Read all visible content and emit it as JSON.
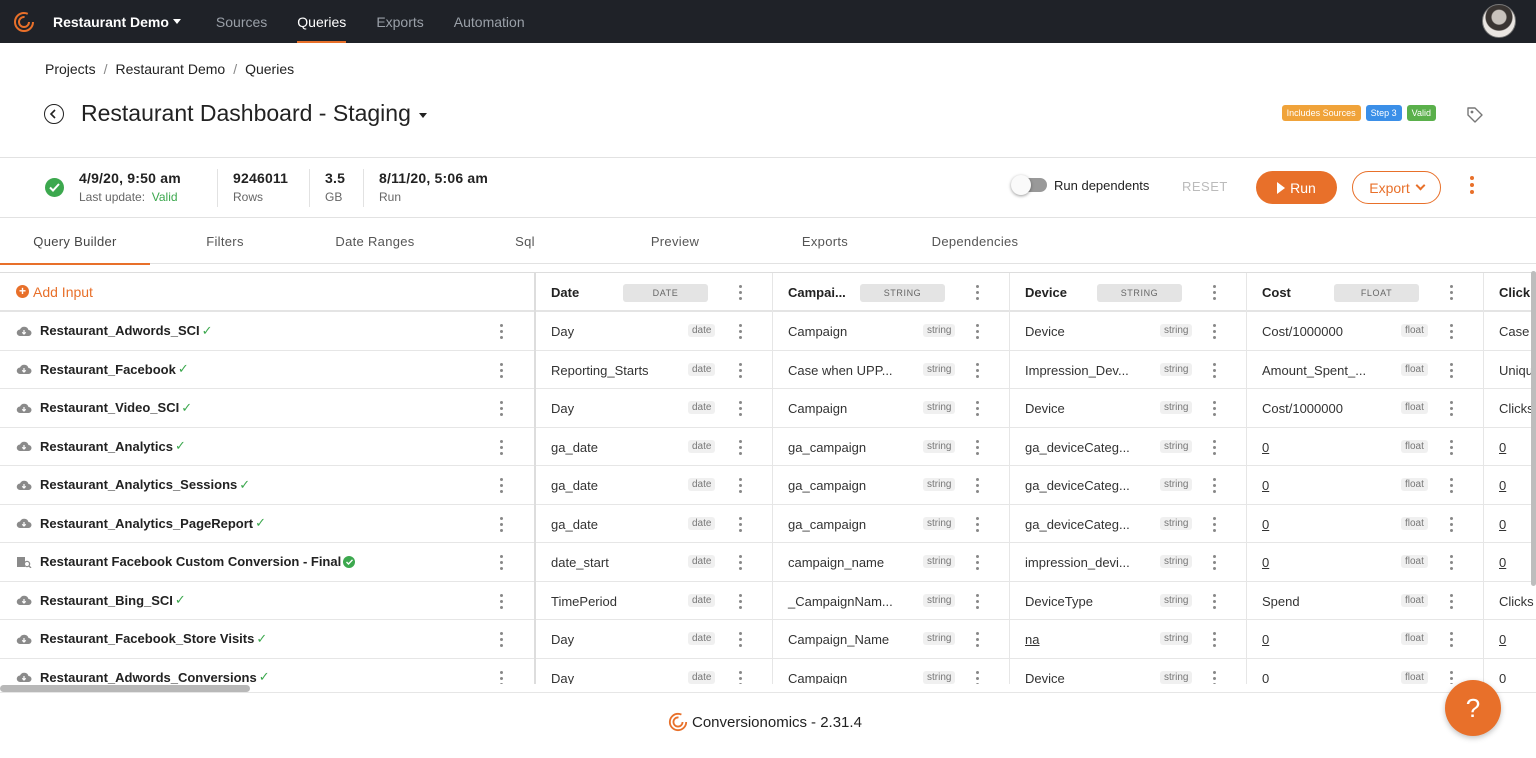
{
  "nav": {
    "project": "Restaurant Demo",
    "links": [
      "Sources",
      "Queries",
      "Exports",
      "Automation"
    ],
    "active": "Queries"
  },
  "breadcrumb": [
    "Projects",
    "Restaurant Demo",
    "Queries"
  ],
  "title": "Restaurant Dashboard - Staging",
  "badges": [
    {
      "label": "Includes Sources",
      "color": "#f0a33a"
    },
    {
      "label": "Step 3",
      "color": "#3b8fe8"
    },
    {
      "label": "Valid",
      "color": "#5ab04b"
    }
  ],
  "info": {
    "last_update_value": "4/9/20, 9:50 am",
    "last_update_label": "Last update:",
    "last_update_status": "Valid",
    "rows_value": "9246011",
    "rows_label": "Rows",
    "size_value": "3.5",
    "size_label": "GB",
    "run_value": "8/11/20, 5:06 am",
    "run_label": "Run",
    "run_dependents": "Run dependents",
    "reset": "RESET",
    "run_button": "Run",
    "export_button": "Export"
  },
  "tabs": [
    "Query Builder",
    "Filters",
    "Date Ranges",
    "Sql",
    "Preview",
    "Exports",
    "Dependencies"
  ],
  "grid": {
    "add_input": "Add Input",
    "sources": [
      {
        "name": "Restaurant_Adwords_SCI",
        "icon": "cloud-icon",
        "check": "mark"
      },
      {
        "name": "Restaurant_Facebook",
        "icon": "cloud-icon",
        "check": "mark"
      },
      {
        "name": "Restaurant_Video_SCI",
        "icon": "cloud-icon",
        "check": "mark"
      },
      {
        "name": "Restaurant_Analytics",
        "icon": "cloud-icon",
        "check": "mark"
      },
      {
        "name": "Restaurant_Analytics_Sessions",
        "icon": "cloud-icon",
        "check": "mark"
      },
      {
        "name": "Restaurant_Analytics_PageReport",
        "icon": "cloud-icon",
        "check": "mark"
      },
      {
        "name": "Restaurant Facebook Custom Conversion - Final",
        "icon": "query-icon",
        "check": "circle"
      },
      {
        "name": "Restaurant_Bing_SCI",
        "icon": "cloud-icon",
        "check": "mark"
      },
      {
        "name": "Restaurant_Facebook_Store Visits",
        "icon": "cloud-icon",
        "check": "mark"
      },
      {
        "name": "Restaurant_Adwords_Conversions",
        "icon": "cloud-icon",
        "check": "mark"
      }
    ],
    "columns": [
      {
        "name": "Date",
        "type": "DATE",
        "cell_type": "date",
        "values": [
          "Day",
          "Reporting_Starts",
          "Day",
          "ga_date",
          "ga_date",
          "ga_date",
          "date_start",
          "TimePeriod",
          "Day",
          "Day"
        ],
        "underline": []
      },
      {
        "name": "Campai...",
        "type": "STRING",
        "cell_type": "string",
        "values": [
          "Campaign",
          "Case when UPP...",
          "Campaign",
          "ga_campaign",
          "ga_campaign",
          "ga_campaign",
          "campaign_name",
          "_CampaignNam...",
          "Campaign_Name",
          "Campaign"
        ],
        "underline": []
      },
      {
        "name": "Device",
        "type": "STRING",
        "cell_type": "string",
        "values": [
          "Device",
          "Impression_Dev...",
          "Device",
          "ga_deviceCateg...",
          "ga_deviceCateg...",
          "ga_deviceCateg...",
          "impression_devi...",
          "DeviceType",
          "na",
          "Device"
        ],
        "underline": [
          8
        ]
      },
      {
        "name": "Cost",
        "type": "FLOAT",
        "cell_type": "float",
        "values": [
          "Cost/1000000",
          "Amount_Spent_...",
          "Cost/1000000",
          "0",
          "0",
          "0",
          "0",
          "Spend",
          "0",
          "0"
        ],
        "underline": [
          3,
          4,
          5,
          6,
          8,
          9
        ]
      },
      {
        "name": "Click",
        "type": "",
        "cell_type": "",
        "values": [
          "Case",
          "Uniqu",
          "Clicks",
          "0",
          "0",
          "0",
          "0",
          "Clicks",
          "0",
          "0"
        ],
        "underline": [
          3,
          4,
          5,
          6,
          8,
          9
        ]
      }
    ]
  },
  "footer": {
    "brand": "Conversionomics",
    "version": "- 2.31.4"
  },
  "help": "?",
  "colors": {
    "accent": "#e8702a",
    "valid": "#3ca84e",
    "nav_bg": "#1f2228"
  }
}
